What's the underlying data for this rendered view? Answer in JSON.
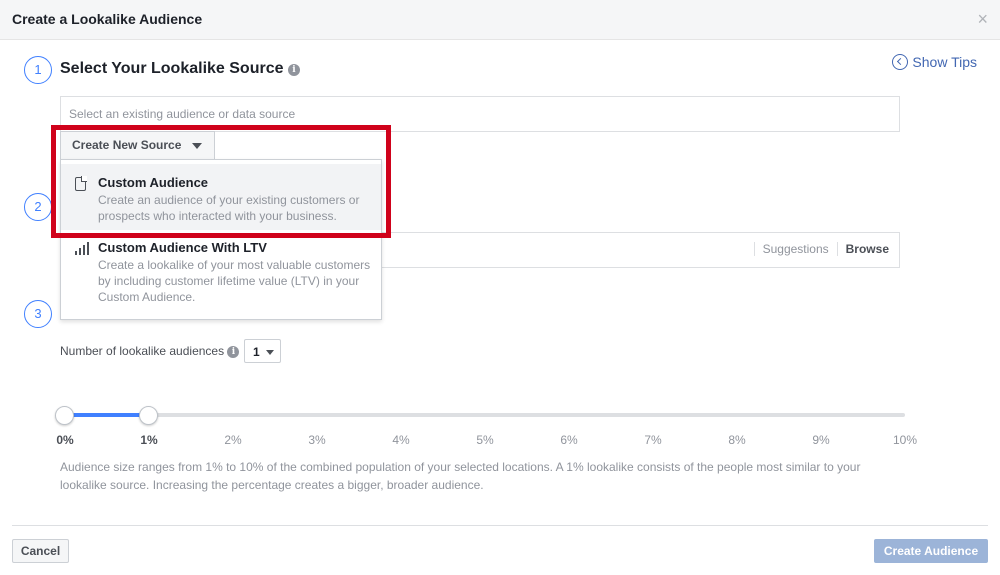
{
  "dialog": {
    "title": "Create a Lookalike Audience",
    "close_glyph": "×"
  },
  "steps": [
    "1",
    "2",
    "3"
  ],
  "source": {
    "title": "Select Your Lookalike Source",
    "info_glyph": "i",
    "show_tips": "Show Tips",
    "input_placeholder": "Select an existing audience or data source",
    "create_button": "Create New Source"
  },
  "dropdown": {
    "items": [
      {
        "title": "Custom Audience",
        "description": "Create an audience of your existing customers or prospects who interacted with your business.",
        "icon": "file-icon",
        "highlighted": true
      },
      {
        "title": "Custom Audience With LTV",
        "description": "Create a lookalike of your most valuable customers by including customer lifetime value (LTV) in your Custom Audience.",
        "icon": "bar-chart-icon",
        "highlighted": false
      }
    ]
  },
  "location": {
    "suggestions": "Suggestions",
    "browse": "Browse"
  },
  "audience_size": {
    "count_label": "Number of lookalike audiences",
    "count_value": "1",
    "slider_range": [
      0,
      1
    ],
    "ticks": [
      "0%",
      "1%",
      "2%",
      "3%",
      "4%",
      "5%",
      "6%",
      "7%",
      "8%",
      "9%",
      "10%"
    ],
    "help_text": "Audience size ranges from 1% to 10% of the combined population of your selected locations. A 1% lookalike consists of the people most similar to your lookalike source. Increasing the percentage creates a bigger, broader audience."
  },
  "footer": {
    "cancel": "Cancel",
    "create": "Create Audience"
  },
  "colors": {
    "accent": "#4080ff",
    "link": "#4267b2",
    "highlight_border": "#d0021b",
    "disabled_primary": "#9cb4d8"
  }
}
